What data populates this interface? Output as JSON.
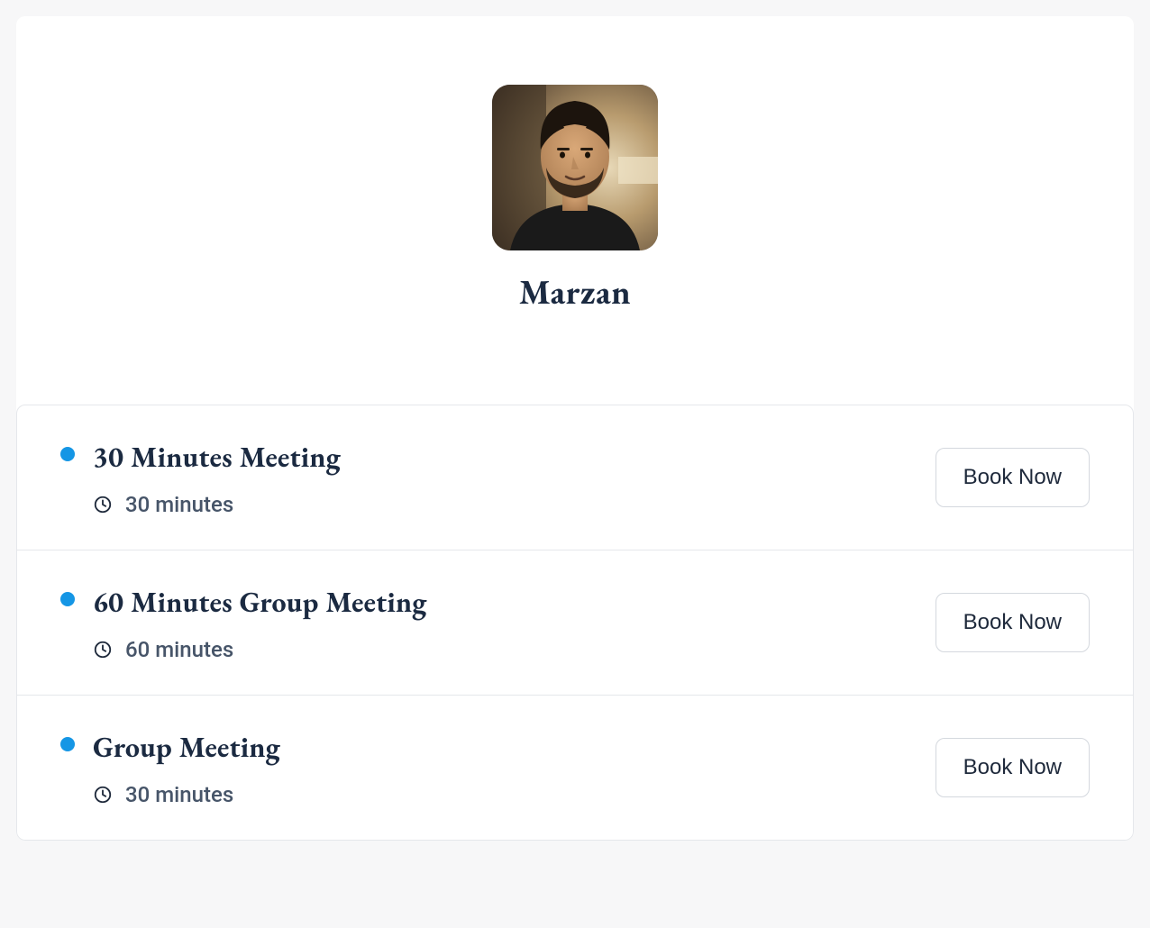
{
  "host": {
    "name": "Marzan"
  },
  "meetings": [
    {
      "title": "30 Minutes Meeting",
      "duration": "30 minutes",
      "book_label": "Book Now",
      "dot_color": "#1596e5"
    },
    {
      "title": "60 Minutes Group Meeting",
      "duration": "60 minutes",
      "book_label": "Book Now",
      "dot_color": "#1596e5"
    },
    {
      "title": "Group Meeting",
      "duration": "30 minutes",
      "book_label": "Book Now",
      "dot_color": "#1596e5"
    }
  ]
}
